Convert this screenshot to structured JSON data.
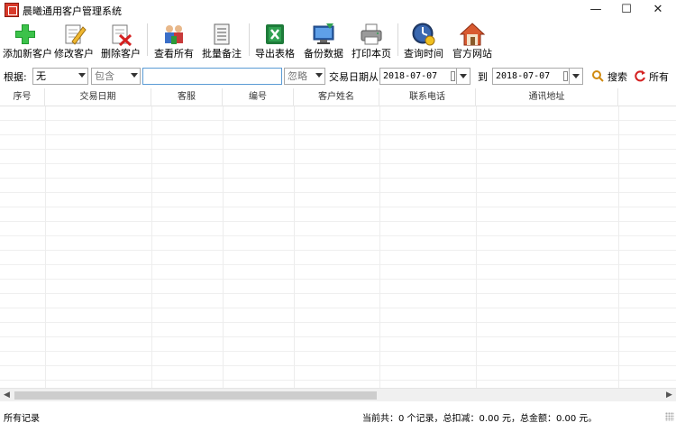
{
  "window": {
    "title": "晨曦通用客户管理系统",
    "controls": [
      "minimize",
      "maximize",
      "close"
    ]
  },
  "toolbar": {
    "buttons": [
      {
        "label": "添加新客户",
        "icon": "add-icon"
      },
      {
        "label": "修改客户",
        "icon": "edit-icon"
      },
      {
        "label": "删除客户",
        "icon": "delete-icon"
      },
      {
        "label": "查看所有",
        "icon": "view-all-icon"
      },
      {
        "label": "批量备注",
        "icon": "notes-icon"
      },
      {
        "label": "导出表格",
        "icon": "excel-icon"
      },
      {
        "label": "备份数据",
        "icon": "backup-icon"
      },
      {
        "label": "打印本页",
        "icon": "printer-icon"
      },
      {
        "label": "查询时间",
        "icon": "clock-icon"
      },
      {
        "label": "官方网站",
        "icon": "home-icon"
      }
    ]
  },
  "filter": {
    "label": "根据:",
    "field_select": "无",
    "match_select": "包含",
    "keyword_value": "",
    "case_select": "忽略",
    "date_from_label": "交易日期从:",
    "date_from": "2018-07-07",
    "date_to_label": "到",
    "date_to": "2018-07-07",
    "search_label": "搜索",
    "all_label": "所有"
  },
  "table": {
    "columns": [
      "序号",
      "交易日期",
      "客服",
      "编号",
      "客户姓名",
      "联系电话",
      "通讯地址"
    ],
    "rows": []
  },
  "status": {
    "left": "所有记录",
    "right": "当前共：0 个记录，总扣减：0.00 元，总金额：0.00 元。"
  },
  "colors": {
    "accent_blue": "#5b9bd5",
    "app_icon_red": "#d83a2a"
  }
}
